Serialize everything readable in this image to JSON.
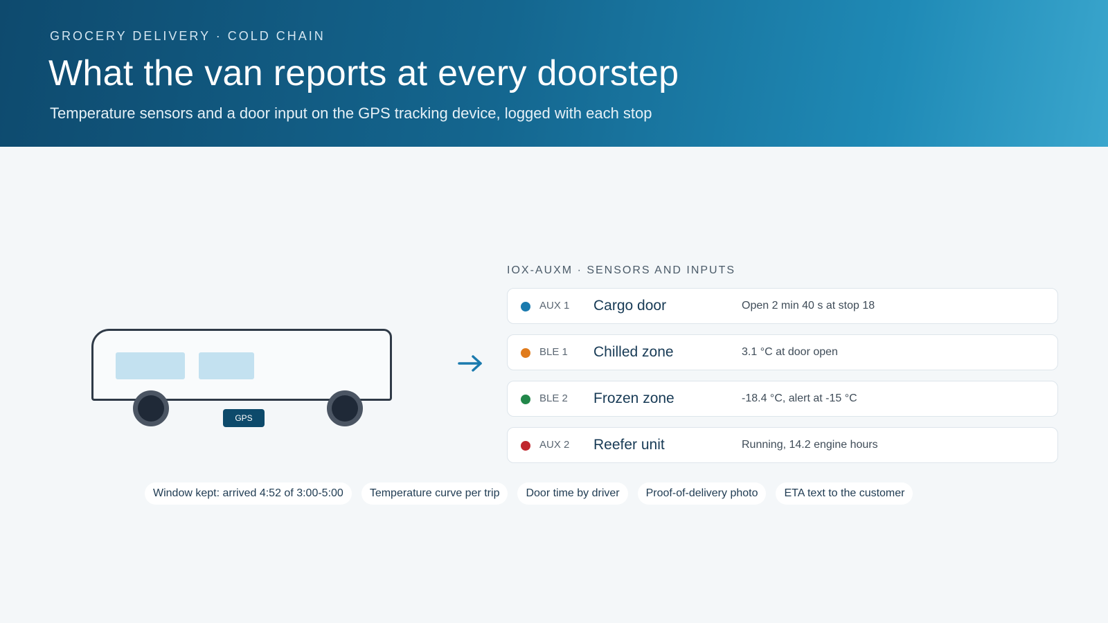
{
  "header": {
    "eyebrow": "GROCERY DELIVERY · COLD CHAIN",
    "title": "What the van reports at every doorstep",
    "subtitle": "Temperature  sensors and a door input on the GPS tracking device, logged with each stop"
  },
  "van": {
    "gps_label": "GPS"
  },
  "sensors": {
    "heading": "IOX-AUXM · SENSORS AND INPUTS",
    "items": [
      {
        "id": "AUX 1",
        "name": "Cargo door",
        "status": "Open 2 min 40 s at stop 18",
        "color": "#1a7aae"
      },
      {
        "id": "BLE 1",
        "name": "Chilled zone",
        "status": "3.1 °C at door open",
        "color": "#e07b1c"
      },
      {
        "id": "BLE 2",
        "name": "Frozen zone",
        "status": "-18.4 °C, alert at -15 °C",
        "color": "#22874a"
      },
      {
        "id": "AUX 2",
        "name": "Reefer unit",
        "status": "Running, 14.2 engine hours",
        "color": "#c0262d"
      }
    ]
  },
  "outcomes": [
    "Window kept: arrived 4:52 of 3:00-5:00",
    "Temperature  curve per trip",
    "Door time by driver",
    "Proof-of-delivery  photo",
    "ETA text  to the customer"
  ],
  "colors": {
    "header_start": "#0e4a6e",
    "header_end": "#3aa6cd",
    "arrow": "#1a7aae",
    "gps_badge": "#0d4a6b"
  },
  "icons": {
    "arrow": "arrow-right-icon",
    "van": "van-icon"
  }
}
